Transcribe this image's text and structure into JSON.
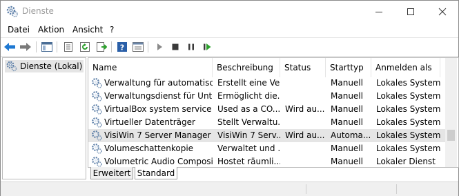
{
  "window": {
    "title": "Dienste"
  },
  "menu": {
    "items": [
      "Datei",
      "Aktion",
      "Ansicht",
      "?"
    ]
  },
  "toolbar": {
    "icons": [
      "back-arrow-icon",
      "forward-arrow-icon",
      "show-hide-console-tree-icon",
      "properties-icon",
      "refresh-icon",
      "export-list-icon",
      "help-icon",
      "view-icon",
      "start-service-icon",
      "stop-service-icon",
      "pause-service-icon",
      "restart-service-icon"
    ]
  },
  "tree": {
    "root_label": "Dienste (Lokal)"
  },
  "table": {
    "columns": [
      "Name",
      "Beschreibung",
      "Status",
      "Starttyp",
      "Anmelden als"
    ],
    "rows": [
      [
        "Verwaltung für automatisch...",
        "Erstellt eine Ve...",
        "",
        "Manuell",
        "Lokales System"
      ],
      [
        "Verwaltungsdienst für Unter...",
        "Ermöglicht die...",
        "",
        "Manuell",
        "Lokales System"
      ],
      [
        "VirtualBox system service",
        "Used as a CO...",
        "Wird au...",
        "Manuell",
        "Lokales System"
      ],
      [
        "Virtueller Datenträger",
        "Stellt Verwaltu...",
        "",
        "Manuell",
        "Lokales System"
      ],
      [
        "VisiWin 7 Server Manager",
        "VisiWin 7 Serv...",
        "Wird au...",
        "Automa...",
        "Lokales System"
      ],
      [
        "Volumeschattenkopie",
        "Verwaltet und ...",
        "",
        "Manuell",
        "Lokales System"
      ],
      [
        "Volumetric Audio Composit...",
        "Hostet räumli...",
        "",
        "Manuell",
        "Lokaler Dienst"
      ]
    ],
    "selected_row_index": 4
  },
  "tabs": [
    "Erweitert",
    "Standard"
  ],
  "active_tab": "Standard",
  "colors": {
    "accent_blue": "#1e78d2",
    "selection_gray": "#e5e5e5",
    "play_green": "#2ca02c"
  }
}
